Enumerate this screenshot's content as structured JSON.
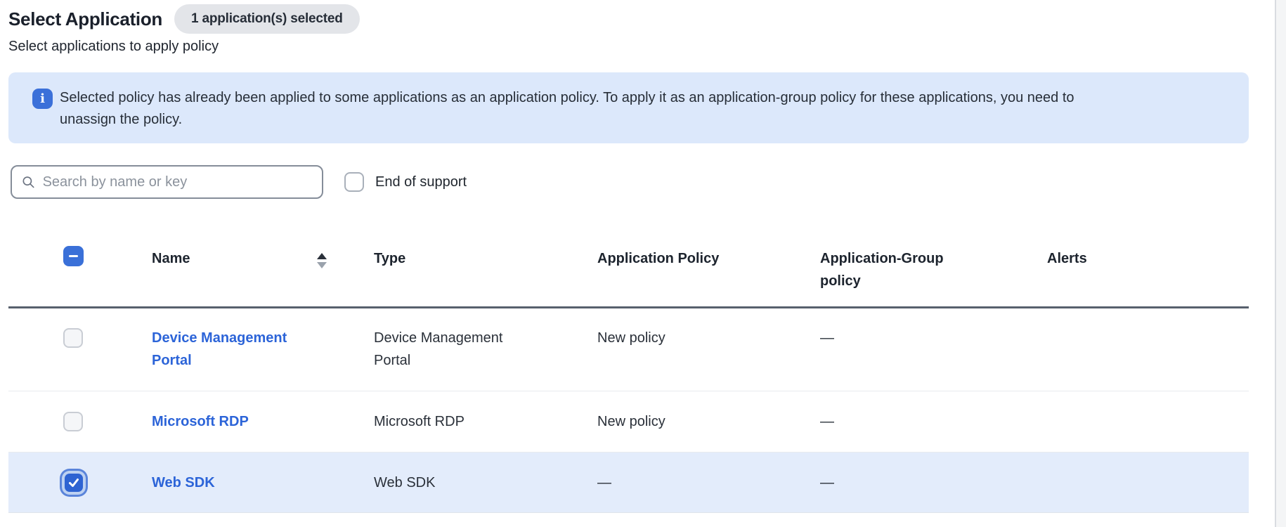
{
  "page": {
    "title": "Select Application",
    "selection_badge": "1 application(s) selected",
    "subtitle": "Select applications to apply policy"
  },
  "banner": {
    "icon": "info-icon",
    "text": "Selected policy has already been applied to some applications as an application policy. To apply it as an application-group policy for these applications, you need to unassign the policy."
  },
  "controls": {
    "search_placeholder": "Search by name or key",
    "end_of_support_label": "End of support",
    "end_of_support_checked": false
  },
  "table": {
    "select_all_state": "indeterminate",
    "sort": {
      "column": "Name",
      "direction": "ascending"
    },
    "columns": {
      "name": "Name",
      "type": "Type",
      "application_policy": "Application Policy",
      "application_group_policy": "Application-Group policy",
      "alerts": "Alerts"
    },
    "rows": [
      {
        "name": "Device Management Portal",
        "type": "Device Management Portal",
        "application_policy": "New policy",
        "application_group_policy": "—",
        "alerts": "",
        "selected": false
      },
      {
        "name": "Microsoft RDP",
        "type": "Microsoft RDP",
        "application_policy": "New policy",
        "application_group_policy": "—",
        "alerts": "",
        "selected": false
      },
      {
        "name": "Web SDK",
        "type": "Web SDK",
        "application_policy": "—",
        "application_group_policy": "—",
        "alerts": "",
        "selected": true
      }
    ]
  },
  "colors": {
    "accent_blue": "#2e63d2",
    "link_blue": "#2c64d8",
    "banner_bg": "#dce8fb",
    "selected_row_bg": "#e3ecfb",
    "header_border": "#57606d",
    "badge_bg": "#e3e5e9"
  }
}
